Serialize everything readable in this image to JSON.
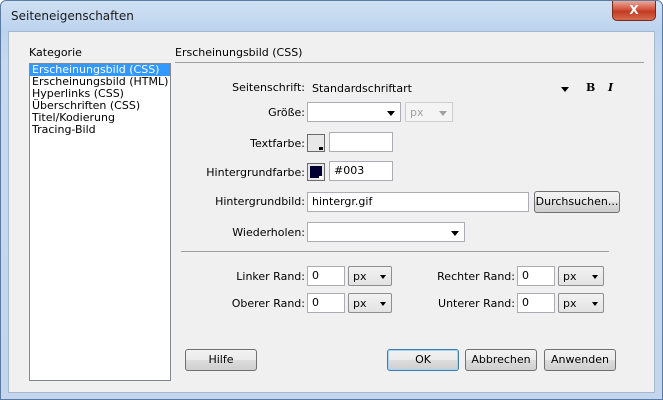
{
  "window": {
    "title": "Seiteneigenschaften",
    "close_glyph": "X"
  },
  "category": {
    "label": "Kategorie",
    "items": [
      {
        "label": "Erscheinungsbild (CSS)",
        "selected": true
      },
      {
        "label": "Erscheinungsbild (HTML)",
        "selected": false
      },
      {
        "label": "Hyperlinks (CSS)",
        "selected": false
      },
      {
        "label": "Überschriften (CSS)",
        "selected": false
      },
      {
        "label": "Titel/Kodierung",
        "selected": false
      },
      {
        "label": "Tracing-Bild",
        "selected": false
      }
    ]
  },
  "section": {
    "title": "Erscheinungsbild (CSS)"
  },
  "fields": {
    "font_label": "Seitenschrift:",
    "font_value": "Standardschriftart",
    "bold_glyph": "B",
    "italic_glyph": "I",
    "size_label": "Größe:",
    "size_value": "",
    "size_unit": "px",
    "textcolor_label": "Textfarbe:",
    "textcolor_value": "",
    "bgcolor_label": "Hintergrundfarbe:",
    "bgcolor_value": "#003",
    "bgcolor_hex": "#000033",
    "bgimage_label": "Hintergrundbild:",
    "bgimage_value": "hintergr.gif",
    "browse_label": "Durchsuchen...",
    "repeat_label": "Wiederholen:",
    "repeat_value": ""
  },
  "margins": {
    "left_label": "Linker Rand:",
    "left_value": "0",
    "left_unit": "px",
    "top_label": "Oberer Rand:",
    "top_value": "0",
    "top_unit": "px",
    "right_label": "Rechter Rand:",
    "right_value": "0",
    "right_unit": "px",
    "bottom_label": "Unterer Rand:",
    "bottom_value": "0",
    "bottom_unit": "px"
  },
  "buttons": {
    "help": "Hilfe",
    "ok": "OK",
    "cancel": "Abbrechen",
    "apply": "Anwenden"
  },
  "colors": {
    "selection": "#3399ff",
    "close": "#c23a21"
  }
}
